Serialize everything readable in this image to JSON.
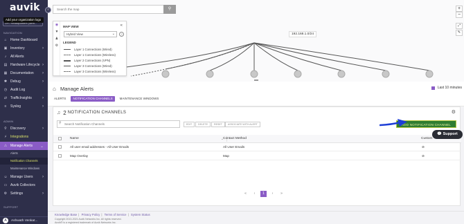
{
  "sidebar": {
    "logo": "auvik",
    "tooltip": "Add your organization logo",
    "org_selector": "DFL Headquarters (dem...",
    "navigation_label": "NAVIGATION",
    "items": [
      {
        "label": "Home Dashboard",
        "icon": "home-icon"
      },
      {
        "label": "Inventory",
        "icon": "box-icon"
      },
      {
        "label": "All Alerts",
        "icon": "bell-icon"
      },
      {
        "label": "Hardware Lifecycle",
        "icon": "server-icon"
      },
      {
        "label": "Documentation",
        "icon": "document-icon"
      },
      {
        "label": "Debug",
        "icon": "bug-icon"
      },
      {
        "label": "Audit Log",
        "icon": "clock-icon"
      },
      {
        "label": "TrafficInsights",
        "icon": "traffic-icon"
      },
      {
        "label": "Syslog",
        "icon": "list-icon"
      }
    ],
    "admin_label": "ADMIN",
    "admin_items": [
      {
        "label": "Discovery",
        "icon": "discovery-icon"
      },
      {
        "label": "Integrations",
        "icon": "plug-icon"
      },
      {
        "label": "Manage Alerts",
        "icon": "alert-icon"
      }
    ],
    "sub_items": [
      "Alerts",
      "Notification Channels",
      "Maintenance Windows"
    ],
    "admin_items_2": [
      {
        "label": "Manage Users",
        "icon": "users-icon"
      },
      {
        "label": "Auvik Collectors",
        "icon": "collector-icon"
      },
      {
        "label": "Settings",
        "icon": "gear-icon"
      }
    ],
    "support_label": "SUPPORT",
    "user": {
      "initial": "A",
      "name": "Ashwath Venkat..."
    }
  },
  "map": {
    "search_placeholder": "Search the map",
    "panel_title": "MAP VIEW",
    "view_select": "Hybrid View",
    "legend_title": "LEGEND",
    "legend": [
      {
        "label": "Layer 1 Connections (Wired)",
        "style": "solid"
      },
      {
        "label": "Layer 1 Connections (Wireless)",
        "style": "dashed"
      },
      {
        "label": "Layer 2 Connections (VPN)",
        "style": "thick"
      },
      {
        "label": "Layer 3 Connections (Wired)",
        "style": "solid"
      },
      {
        "label": "Layer 3 Connections (Wireless)",
        "style": "dashed"
      }
    ],
    "network_label": "192.168.1.0/24"
  },
  "manage_alerts": {
    "title": "Manage Alerts",
    "time_range": "Last 10 minutes",
    "tabs": [
      "ALERTS",
      "NOTIFICATION CHANNELS",
      "MAINTENANCE WINDOWS"
    ],
    "active_tab": 1
  },
  "channels": {
    "count": "2",
    "title": "NOTIFICATION CHANNELS",
    "search_placeholder": "Search Notification Channels",
    "buttons": [
      "EDIT",
      "DELETE",
      "RESET",
      "ASSOCIATE WITH ALERT"
    ],
    "add_button": "ADD NOTIFICATION CHANNEL",
    "columns": [
      "Name",
      "Contact Method",
      "Custom"
    ],
    "rows": [
      {
        "name": "All user email addresses - All User Emails",
        "method": "All User Emails",
        "custom": "⊘"
      },
      {
        "name": "Map Overlay",
        "method": "Map",
        "custom": "⊘"
      }
    ],
    "pager": {
      "prev_first": "«",
      "prev": "‹",
      "current": "1",
      "next": "›",
      "last": "»"
    }
  },
  "footer": {
    "links": [
      "Knowledge Base",
      "Privacy Policy",
      "Terms of Service",
      "System Status"
    ],
    "copyright": "Copyright 2013-2021 Auvik Networks Inc. All rights reserved.",
    "trademark": "Auvik® is a registered trademark of Auvik Networks Inc.",
    "support_button": "Support"
  },
  "colors": {
    "accent": "#8a5cc6",
    "sidebar": "#2e2f4a",
    "add_button": "#2f7d32",
    "arrow": "#1e3fd6"
  }
}
